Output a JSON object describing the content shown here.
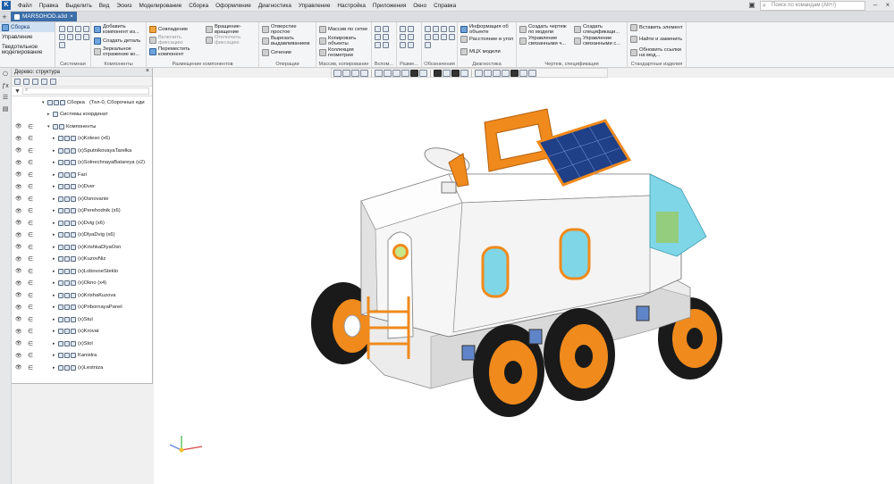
{
  "menubar": {
    "items": [
      "Файл",
      "Правка",
      "Выделить",
      "Вид",
      "Эскиз",
      "Моделирование",
      "Сборка",
      "Оформление",
      "Диагностика",
      "Управление",
      "Настройка",
      "Приложения",
      "Окно",
      "Справка"
    ],
    "search_placeholder": "Поиск по командам (Alt+/)"
  },
  "tabbar": {
    "doc_title": "MARSOHOD.a3d",
    "close": "×"
  },
  "ribbon": {
    "left": [
      "Сборка",
      "Управление",
      "Тведотельное моделирование"
    ],
    "groups": {
      "g1": {
        "label": "Системная"
      },
      "g2": {
        "label": "Компоненты",
        "btn1": "Добавить компонент из...",
        "btn2": "Создать деталь",
        "btn3": "Зеркальное отражение ко..."
      },
      "g3": {
        "label": "Размещение компонентов",
        "btn1": "Совпадение",
        "btn2": "Включить фиксацию",
        "btn3": "Переместить компонент",
        "btn4": "Вращение-вращение",
        "btn5": "Отключить фиксацию"
      },
      "g4": {
        "label": "Операции",
        "btn1": "Отверстие простое",
        "btn2": "Вырезать выдавливанием",
        "btn3": "Сечение"
      },
      "g5": {
        "label": "Массив, копирование",
        "btn1": "Массив по сетке",
        "btn2": "Копировать объекты",
        "btn3": "Коллекция геометрии"
      },
      "g6": {
        "label": "Вспом..."
      },
      "g7": {
        "label": "Разме..."
      },
      "g8": {
        "label": "Обозначения"
      },
      "g9": {
        "label": "Диагностика",
        "btn1": "Информация об объекте",
        "btn2": "Расстояние и угол",
        "btn3": "МЦХ модели"
      },
      "g10": {
        "label": "Чертеж, спецификация",
        "btn1": "Создать чертеж по модели",
        "btn2": "Управление связанными ч...",
        "btn3": "Создать спецификаци...",
        "btn4": "Управление связанными с..."
      },
      "g11": {
        "label": "Стандартные изделия",
        "btn1": "Вставить элемент",
        "btn2": "Найти и заменить",
        "btn3": "Обновить ссылки на мод..."
      }
    }
  },
  "tree": {
    "title": "Дерево: структура",
    "close": "×",
    "root": "(Тел-0, Сборочных еди",
    "root_prefix": "Сборка",
    "coord": "Системы координат",
    "components": "Компоненты",
    "items": [
      "(x)Koleso (x6)",
      "(x)SputnikovayaTarelka",
      "(x)SolnechnayaBatareya (x2)",
      "Fari",
      "(x)Dver",
      "(x)Osnovanie",
      "(x)Perehodnik (x6)",
      "(x)Dvig (x6)",
      "(x)DlyaDvig (x6)",
      "(x)KrishkaDlyaOsn",
      "(x)KuzovNiz",
      "(x)LobovoeSteklo",
      "(x)Okno (x4)",
      "(x)KrishaKuzova",
      "(x)PribornayaPanel",
      "(x)Stul",
      "(x)Krovat",
      "(x)Stol",
      "Kanistra",
      "(x)Lestniza"
    ]
  },
  "colors": {
    "accent": "#3c6ea8",
    "orange": "#f08a1c",
    "solar": "#1f3f86",
    "glass": "#7fd6e6",
    "body": "#f7f7f7",
    "tire": "#1a1a1a"
  }
}
